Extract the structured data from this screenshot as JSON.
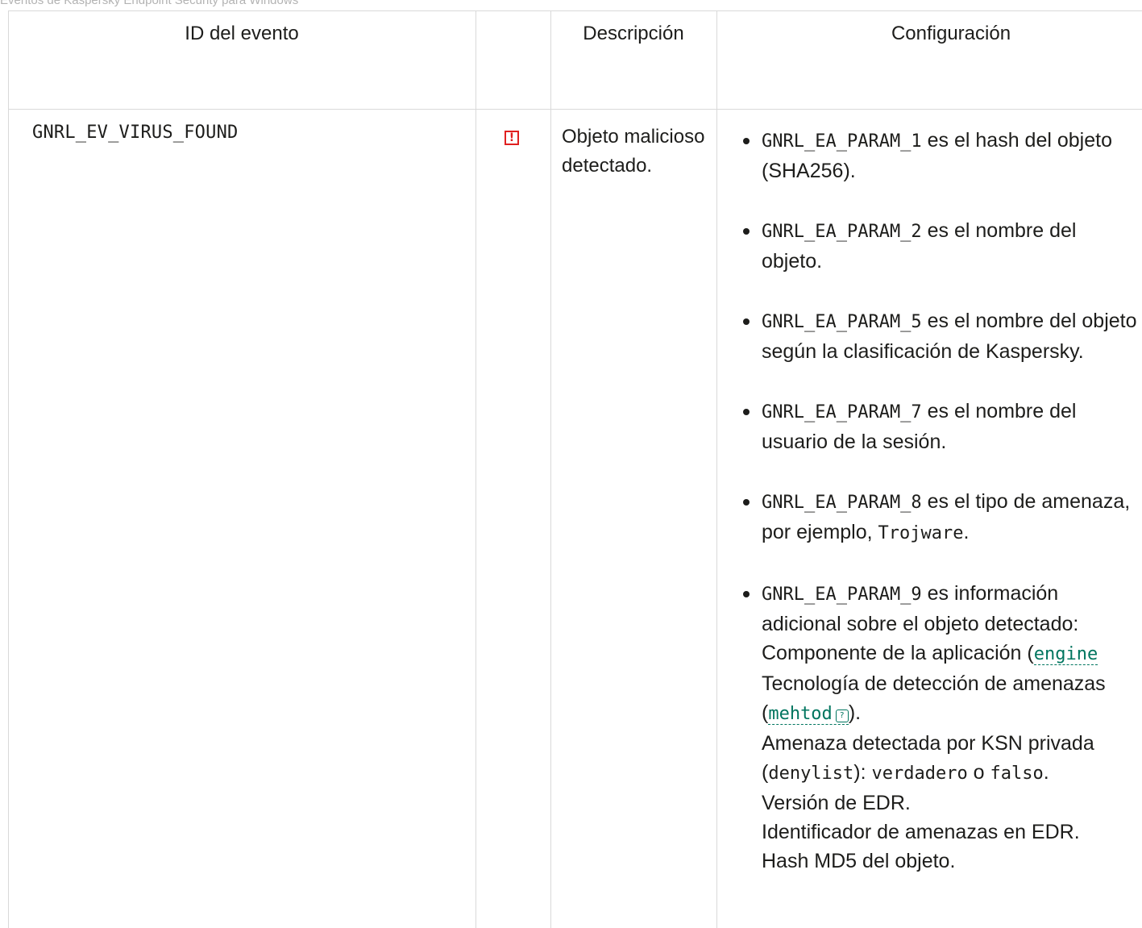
{
  "breadcrumb": "Eventos de Kaspersky Endpoint Security para Windows",
  "table": {
    "headers": {
      "event_id": "ID del evento",
      "description": "Descripción",
      "settings": "Configuración"
    },
    "row": {
      "event_id": "GNRL_EV_VIRUS_FOUND",
      "severity_icon": "alert-icon",
      "description": "Objeto malicioso detectado.",
      "params": [
        {
          "code": "GNRL_EA_PARAM_1",
          "text": " es el hash del objeto (SHA256)."
        },
        {
          "code": "GNRL_EA_PARAM_2",
          "text": " es el nombre del objeto."
        },
        {
          "code": "GNRL_EA_PARAM_5",
          "text": " es el nombre del objeto según la clasificación de Kaspersky."
        },
        {
          "code": "GNRL_EA_PARAM_7",
          "text": " es el nombre del usuario de la sesión."
        },
        {
          "code": "GNRL_EA_PARAM_8",
          "text": " es el tipo de amenaza, por ejemplo, ",
          "example": "Trojware",
          "end": "."
        },
        {
          "code": "GNRL_EA_PARAM_9",
          "text": " es información adicional sobre el objeto detectado:",
          "component_prefix": "Componente de la aplicación (",
          "component_link": "engine",
          "tech_label": "Tecnología de detección de amenazas",
          "tech_link": "mehtod",
          "tech_end": ").",
          "ksn_prefix": "Amenaza detectada por KSN privada",
          "ksn_code": "denylist",
          "ksn_mid": "): ",
          "ksn_true": "verdadero",
          "ksn_or": " o ",
          "ksn_false": "falso",
          "edr_version": "Versión de EDR.",
          "edr_threat_id": "Identificador de amenazas en EDR.",
          "md5": "Hash MD5 del objeto."
        }
      ]
    }
  },
  "colors": {
    "accent": "#00755f",
    "alert": "#e02020",
    "grid": "#d9d9d9"
  }
}
